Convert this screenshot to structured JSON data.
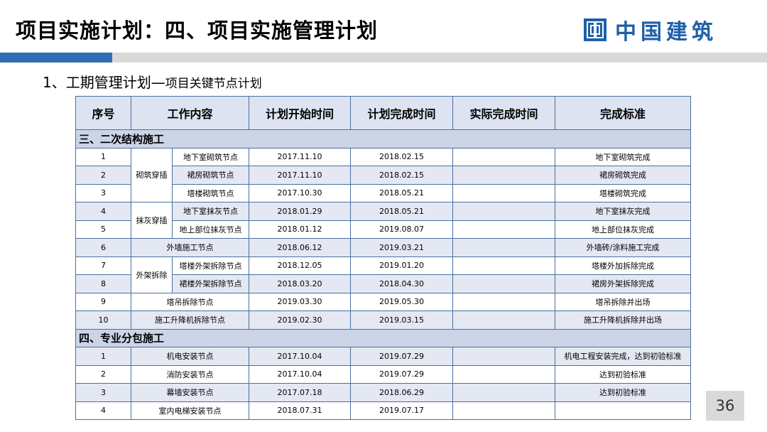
{
  "title": "项目实施计划：四、项目实施管理计划",
  "logo": {
    "icon": "csc-logo-icon",
    "text": "中国建筑"
  },
  "subtitle": {
    "main": "1、工期管理计划—",
    "small": "项目关键节点计划"
  },
  "colors": {
    "accent_bar": "#2f6eb5",
    "header_bg": "#dde3f0",
    "section_bg": "#ccd5e8",
    "row_alt": "#e3e8f3",
    "border": "#4a6f9f",
    "logo": "#1f5fa8"
  },
  "table": {
    "headers": [
      "序号",
      "工作内容",
      "计划开始时间",
      "计划完成时间",
      "实际完成时间",
      "完成标准"
    ],
    "section1": {
      "title": "三、二次结构施工",
      "group_masonry": "砌筑穿插",
      "group_plaster": "抹灰穿插",
      "group_scaffold": "外架拆除",
      "rows": [
        {
          "no": "1",
          "item": "地下室砌筑节点",
          "start": "2017.11.10",
          "finish": "2018.02.15",
          "actual": "",
          "standard": "地下室砌筑完成"
        },
        {
          "no": "2",
          "item": "裙房砌筑节点",
          "start": "2017.11.10",
          "finish": "2018.02.15",
          "actual": "",
          "standard": "裙房砌筑完成"
        },
        {
          "no": "3",
          "item": "塔楼砌筑节点",
          "start": "2017.10.30",
          "finish": "2018.05.21",
          "actual": "",
          "standard": "塔楼砌筑完成"
        },
        {
          "no": "4",
          "item": "地下室抹灰节点",
          "start": "2018.01.29",
          "finish": "2018.05.21",
          "actual": "",
          "standard": "地下室抹灰完成"
        },
        {
          "no": "5",
          "item": "地上部位抹灰节点",
          "start": "2018.01.12",
          "finish": "2019.08.07",
          "actual": "",
          "standard": "地上部位抹灰完成"
        },
        {
          "no": "6",
          "item": "外墙施工节点",
          "start": "2018.06.12",
          "finish": "2019.03.21",
          "actual": "",
          "standard": "外墙砖/涂料施工完成"
        },
        {
          "no": "7",
          "item": "塔楼外架拆除节点",
          "start": "2018.12.05",
          "finish": "2019.01.20",
          "actual": "",
          "standard": "塔楼外加拆除完成"
        },
        {
          "no": "8",
          "item": "裙楼外架拆除节点",
          "start": "2018.03.20",
          "finish": "2018.04.30",
          "actual": "",
          "standard": "裙房外架拆除完成"
        },
        {
          "no": "9",
          "item": "塔吊拆除节点",
          "start": "2019.03.30",
          "finish": "2019.05.30",
          "actual": "",
          "standard": "塔吊拆除并出场"
        },
        {
          "no": "10",
          "item": "施工升降机拆除节点",
          "start": "2019.02.30",
          "finish": "2019.03.15",
          "actual": "",
          "standard": "施工升降机拆除并出场"
        }
      ]
    },
    "section2": {
      "title": "四、专业分包施工",
      "rows": [
        {
          "no": "1",
          "item": "机电安装节点",
          "start": "2017.10.04",
          "finish": "2019.07.29",
          "actual": "",
          "standard": "机电工程安装完成，达到初验标准"
        },
        {
          "no": "2",
          "item": "消防安装节点",
          "start": "2017.10.04",
          "finish": "2019.07.29",
          "actual": "",
          "standard": "达到初验标准"
        },
        {
          "no": "3",
          "item": "幕墙安装节点",
          "start": "2017.07.18",
          "finish": "2018.06.29",
          "actual": "",
          "standard": "达到初验标准"
        },
        {
          "no": "4",
          "item": "室内电梯安装节点",
          "start": "2018.07.31",
          "finish": "2019.07.17",
          "actual": "",
          "standard": ""
        }
      ]
    }
  },
  "page_number": "36"
}
